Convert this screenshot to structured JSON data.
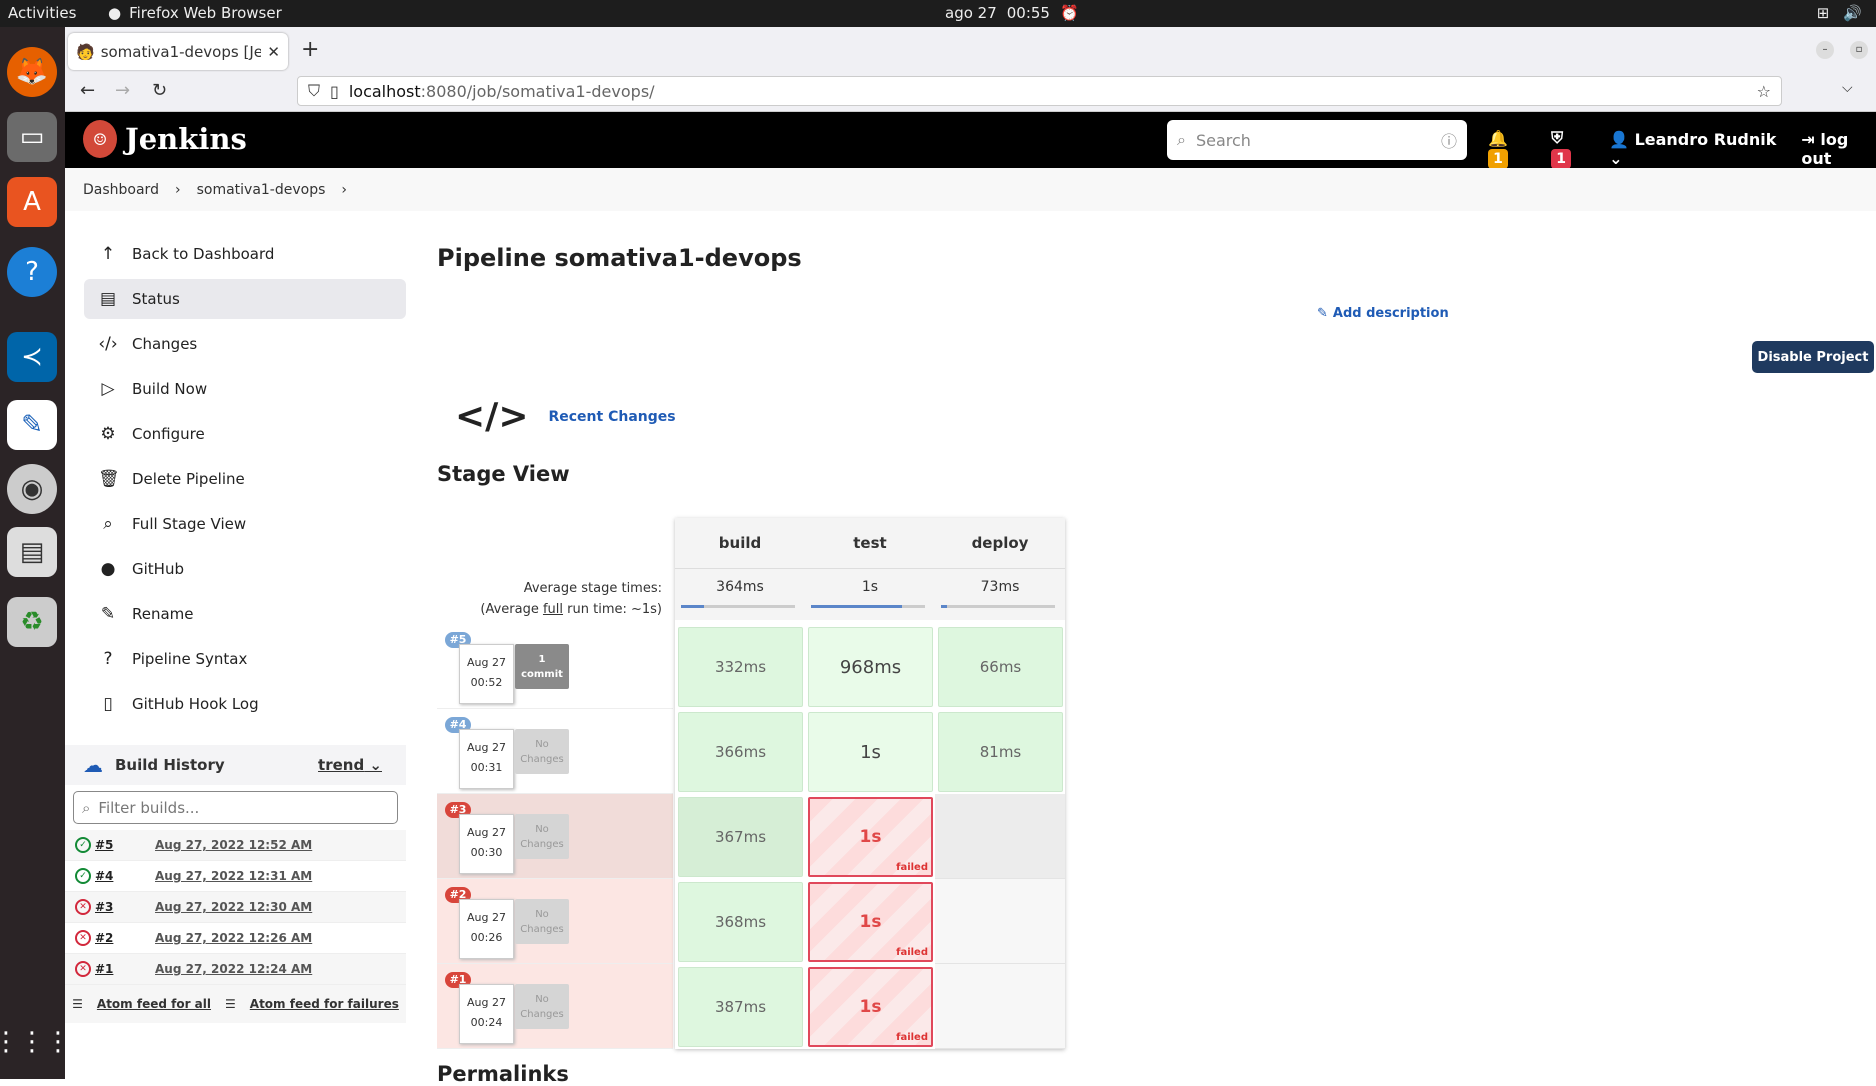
{
  "os": {
    "activities": "Activities",
    "app_name": "Firefox Web Browser",
    "date": "ago 27",
    "time": "00:55"
  },
  "browser": {
    "tab_title": "somativa1-devops [Jenkins]",
    "url_host": "localhost",
    "url_path": ":8080/job/somativa1-devops/"
  },
  "header": {
    "brand": "Jenkins",
    "search_placeholder": "Search",
    "notif_count": "1",
    "security_count": "1",
    "user": "Leandro Rudnik",
    "logout": "log out"
  },
  "breadcrumb": [
    "Dashboard",
    "somativa1-devops"
  ],
  "sidebar": {
    "items": [
      {
        "label": "Back to Dashboard",
        "icon": "arrow-up"
      },
      {
        "label": "Status",
        "icon": "document"
      },
      {
        "label": "Changes",
        "icon": "code"
      },
      {
        "label": "Build Now",
        "icon": "play"
      },
      {
        "label": "Configure",
        "icon": "gear"
      },
      {
        "label": "Delete Pipeline",
        "icon": "trash"
      },
      {
        "label": "Full Stage View",
        "icon": "search"
      },
      {
        "label": "GitHub",
        "icon": "github"
      },
      {
        "label": "Rename",
        "icon": "pencil"
      },
      {
        "label": "Pipeline Syntax",
        "icon": "question"
      },
      {
        "label": "GitHub Hook Log",
        "icon": "clipboard"
      }
    ]
  },
  "build_history": {
    "title": "Build History",
    "trend": "trend",
    "filter_placeholder": "Filter builds...",
    "rows": [
      {
        "num": "#5",
        "date": "Aug 27, 2022 12:52 AM",
        "status": "success"
      },
      {
        "num": "#4",
        "date": "Aug 27, 2022 12:31 AM",
        "status": "success"
      },
      {
        "num": "#3",
        "date": "Aug 27, 2022 12:30 AM",
        "status": "failed"
      },
      {
        "num": "#2",
        "date": "Aug 27, 2022 12:26 AM",
        "status": "failed"
      },
      {
        "num": "#1",
        "date": "Aug 27, 2022 12:24 AM",
        "status": "failed"
      }
    ],
    "feed_all": "Atom feed for all",
    "feed_failures": "Atom feed for failures"
  },
  "main": {
    "title": "Pipeline somativa1-devops",
    "add_description": "Add description",
    "disable": "Disable Project",
    "recent_changes": "Recent Changes",
    "stage_view": "Stage View",
    "permalinks": "Permalinks"
  },
  "stage_view": {
    "stages": [
      "build",
      "test",
      "deploy"
    ],
    "averages": [
      "364ms",
      "1s",
      "73ms"
    ],
    "avg_progress": [
      0.2,
      0.8,
      0.05
    ],
    "avg_label_1": "Average stage times:",
    "avg_label_2a": "(Average ",
    "avg_label_2b": "full",
    "avg_label_2c": " run time: ~1s)",
    "runs": [
      {
        "num": "#5",
        "date": "Aug 27",
        "time": "00:52",
        "changes": "1\ncommit",
        "cells": [
          "332ms",
          "968ms",
          "66ms"
        ],
        "status": "success"
      },
      {
        "num": "#4",
        "date": "Aug 27",
        "time": "00:31",
        "changes": "No\nChanges",
        "cells": [
          "366ms",
          "1s",
          "81ms"
        ],
        "status": "success"
      },
      {
        "num": "#3",
        "date": "Aug 27",
        "time": "00:30",
        "changes": "No\nChanges",
        "cells": [
          "367ms",
          "1s",
          ""
        ],
        "status": "failed"
      },
      {
        "num": "#2",
        "date": "Aug 27",
        "time": "00:26",
        "changes": "No\nChanges",
        "cells": [
          "368ms",
          "1s",
          ""
        ],
        "status": "failed"
      },
      {
        "num": "#1",
        "date": "Aug 27",
        "time": "00:24",
        "changes": "No\nChanges",
        "cells": [
          "387ms",
          "1s",
          ""
        ],
        "status": "failed"
      }
    ],
    "failed_label": "failed"
  }
}
